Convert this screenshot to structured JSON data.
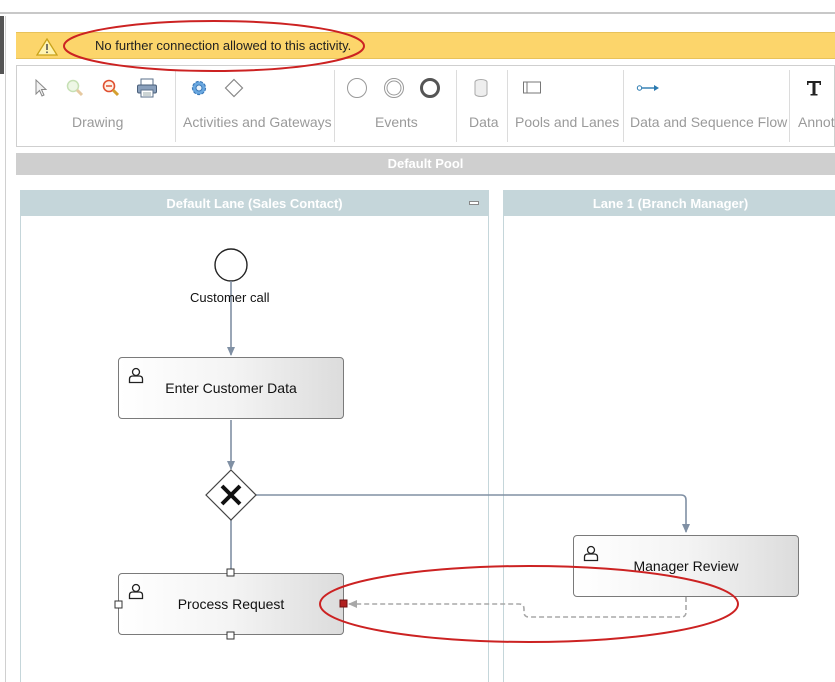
{
  "warning": {
    "message": "No further connection allowed to this activity.",
    "icon": "warning-triangle-icon"
  },
  "toolbar": {
    "groups": [
      {
        "label": "Drawing",
        "tools": [
          "pointer-icon",
          "zoom-in-icon",
          "zoom-out-icon",
          "print-icon"
        ]
      },
      {
        "label": "Activities and Gateways",
        "tools": [
          "task-gear-icon",
          "gateway-diamond-icon"
        ]
      },
      {
        "label": "Events",
        "tools": [
          "start-event-icon",
          "intermediate-event-icon",
          "end-event-icon"
        ]
      },
      {
        "label": "Data",
        "tools": [
          "data-store-icon"
        ]
      },
      {
        "label": "Pools and Lanes",
        "tools": [
          "lane-icon"
        ]
      },
      {
        "label": "Data and Sequence Flow",
        "tools": [
          "sequence-flow-icon"
        ]
      },
      {
        "label": "Annotations",
        "tools": [
          "text-annotation-icon"
        ]
      }
    ]
  },
  "pool": {
    "title": "Default Pool"
  },
  "lanes": [
    {
      "title": "Default Lane (Sales Contact)"
    },
    {
      "title": "Lane 1 (Branch Manager)"
    }
  ],
  "diagram": {
    "start_event_label": "Customer call",
    "tasks": {
      "enter_customer_data": "Enter Customer Data",
      "process_request": "Process Request",
      "manager_review": "Manager Review"
    },
    "gateway": "exclusive-gateway",
    "colors": {
      "flow": "#8090a4",
      "pending_flow": "#a8a8a8",
      "highlight_ellipse": "#cc2222",
      "error_handle": "#b02020"
    }
  }
}
